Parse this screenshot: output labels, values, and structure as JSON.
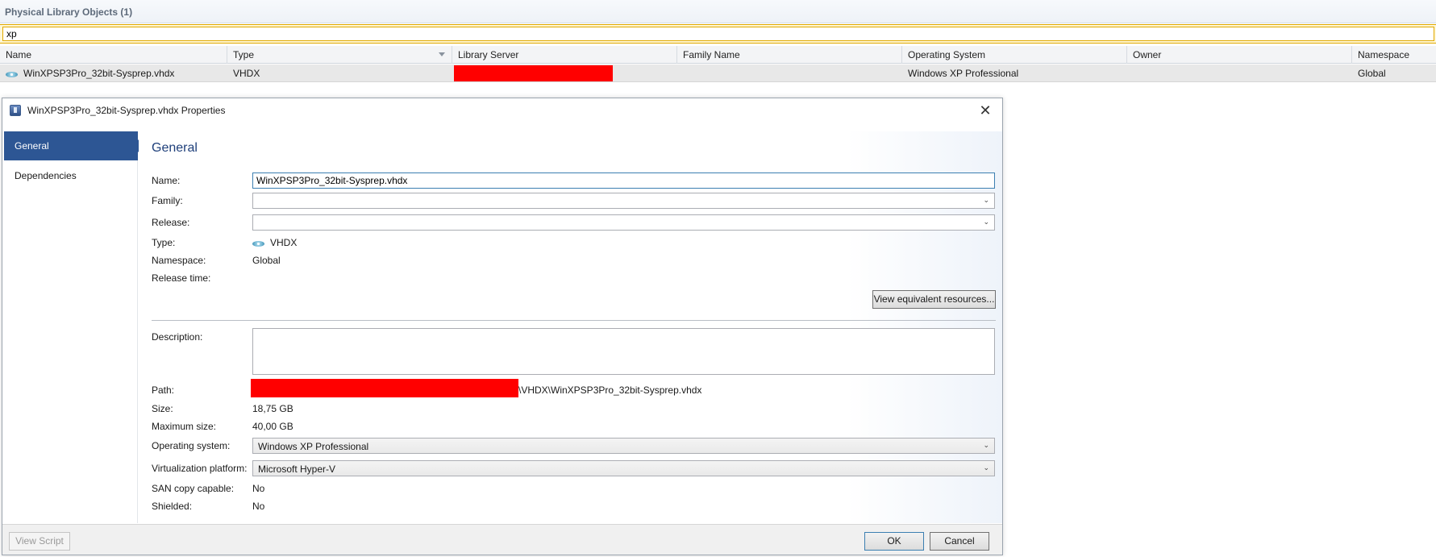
{
  "library": {
    "title": "Physical Library Objects (1)",
    "filter_value": "xp",
    "columns": [
      "Name",
      "Type",
      "Library Server",
      "Family Name",
      "Operating System",
      "Owner",
      "Namespace"
    ],
    "row": {
      "name": "WinXPSP3Pro_32bit-Sysprep.vhdx",
      "type": "VHDX",
      "library_server": "",
      "family_name": "",
      "operating_system": "Windows XP Professional",
      "owner": "",
      "namespace": "Global",
      "icon": "disk-icon"
    }
  },
  "dialog": {
    "title": "WinXPSP3Pro_32bit-Sysprep.vhdx Properties",
    "nav": [
      "General",
      "Dependencies"
    ],
    "section_title": "General",
    "labels": {
      "name": "Name:",
      "family": "Family:",
      "release": "Release:",
      "type": "Type:",
      "namespace": "Namespace:",
      "release_time": "Release time:",
      "description": "Description:",
      "path": "Path:",
      "size": "Size:",
      "max_size": "Maximum size:",
      "os": "Operating system:",
      "virt": "Virtualization platform:",
      "san": "SAN copy capable:",
      "shielded": "Shielded:"
    },
    "values": {
      "name": "WinXPSP3Pro_32bit-Sysprep.vhdx",
      "family": "",
      "release": "",
      "type": "VHDX",
      "namespace": "Global",
      "release_time": "",
      "description": "",
      "path_suffix": "\\VHDX\\WinXPSP3Pro_32bit-Sysprep.vhdx",
      "size": "18,75 GB",
      "max_size": "40,00 GB",
      "os": "Windows XP Professional",
      "virt": "Microsoft Hyper-V",
      "san": "No",
      "shielded": "No"
    },
    "buttons": {
      "view_equivalent": "View equivalent resources...",
      "view_script": "View Script",
      "ok": "OK",
      "cancel": "Cancel"
    },
    "colors": {
      "nav_active": "#2d5694",
      "redaction": "#ff0000",
      "filter_border": "#e0a800"
    }
  }
}
